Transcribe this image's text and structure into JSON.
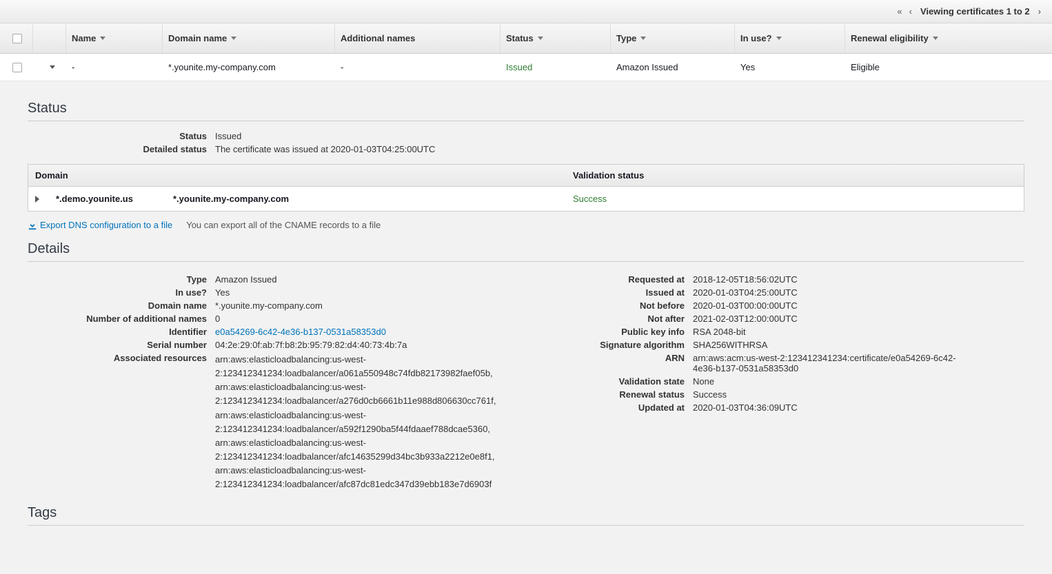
{
  "pager": {
    "text": "Viewing certificates 1 to 2"
  },
  "columns": {
    "name": "Name",
    "domain_name": "Domain name",
    "additional_names": "Additional names",
    "status": "Status",
    "type": "Type",
    "in_use": "In use?",
    "renewal_eligibility": "Renewal eligibility"
  },
  "row": {
    "name": "-",
    "domain_name": "*.younite.my-company.com",
    "additional_names": "-",
    "status": "Issued",
    "type": "Amazon Issued",
    "in_use": "Yes",
    "renewal_eligibility": "Eligible"
  },
  "sections": {
    "status": "Status",
    "details": "Details",
    "tags": "Tags"
  },
  "status_block": {
    "status_label": "Status",
    "status_value": "Issued",
    "detailed_label": "Detailed status",
    "detailed_value": "The certificate was issued at 2020-01-03T04:25:00UTC"
  },
  "validation": {
    "domain_header": "Domain",
    "validation_header": "Validation status",
    "row_domain1": "*.demo.younite.us",
    "row_domain2": "*.younite.my-company.com",
    "row_status": "Success"
  },
  "export": {
    "link": "Export DNS configuration to a file",
    "hint": "You can export all of the CNAME records to a file"
  },
  "details_left": {
    "type_label": "Type",
    "type_value": "Amazon Issued",
    "in_use_label": "In use?",
    "in_use_value": "Yes",
    "domain_label": "Domain name",
    "domain_value": "*.younite.my-company.com",
    "num_additional_label": "Number of additional names",
    "num_additional_value": "0",
    "identifier_label": "Identifier",
    "identifier_value": "e0a54269-6c42-4e36-b137-0531a58353d0",
    "serial_label": "Serial number",
    "serial_value": "04:2e:29:0f:ab:7f:b8:2b:95:79:82:d4:40:73:4b:7a",
    "assoc_label": "Associated resources",
    "assoc_value": "arn:aws:elasticloadbalancing:us-west-2:123412341234:loadbalancer/a061a550948c74fdb82173982faef05b, arn:aws:elasticloadbalancing:us-west-2:123412341234:loadbalancer/a276d0cb6661b11e988d806630cc761f, arn:aws:elasticloadbalancing:us-west-2:123412341234:loadbalancer/a592f1290ba5f44fdaaef788dcae5360, arn:aws:elasticloadbalancing:us-west-2:123412341234:loadbalancer/afc14635299d34bc3b933a2212e0e8f1, arn:aws:elasticloadbalancing:us-west-2:123412341234:loadbalancer/afc87dc81edc347d39ebb183e7d6903f"
  },
  "details_right": {
    "requested_label": "Requested at",
    "requested_value": "2018-12-05T18:56:02UTC",
    "issued_label": "Issued at",
    "issued_value": "2020-01-03T04:25:00UTC",
    "notbefore_label": "Not before",
    "notbefore_value": "2020-01-03T00:00:00UTC",
    "notafter_label": "Not after",
    "notafter_value": "2021-02-03T12:00:00UTC",
    "pubkey_label": "Public key info",
    "pubkey_value": "RSA 2048-bit",
    "sigalg_label": "Signature algorithm",
    "sigalg_value": "SHA256WITHRSA",
    "arn_label": "ARN",
    "arn_value": "arn:aws:acm:us-west-2:123412341234:certificate/e0a54269-6c42-4e36-b137-0531a58353d0",
    "valstate_label": "Validation state",
    "valstate_value": "None",
    "renewstatus_label": "Renewal status",
    "renewstatus_value": "Success",
    "updated_label": "Updated at",
    "updated_value": "2020-01-03T04:36:09UTC"
  }
}
